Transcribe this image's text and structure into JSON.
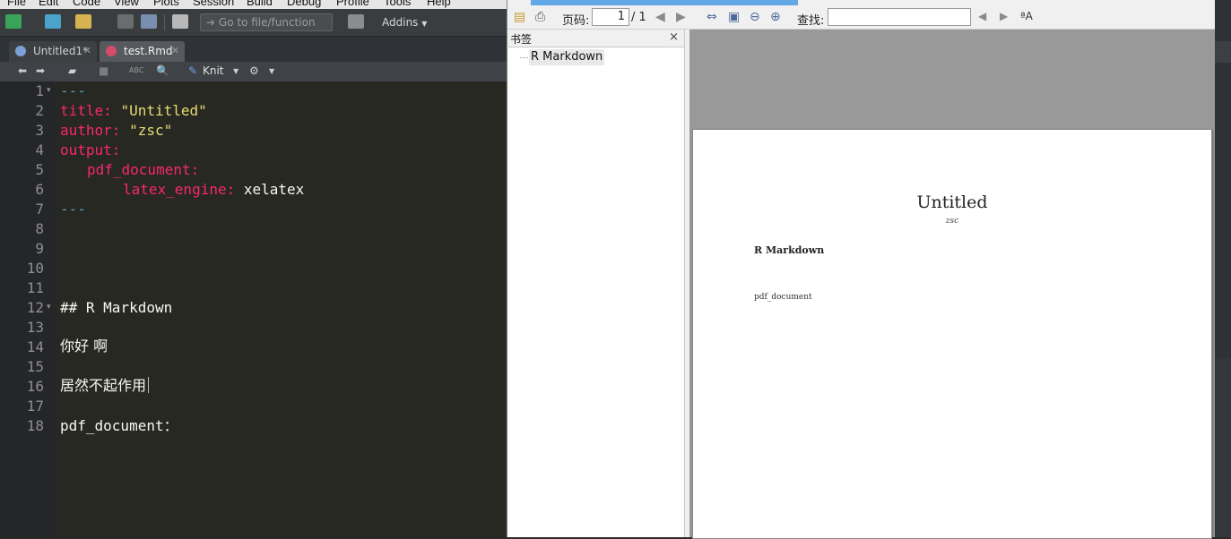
{
  "menubar": {
    "items": [
      "File",
      "Edit",
      "Code",
      "View",
      "Plots",
      "Session",
      "Build",
      "Debug",
      "Profile",
      "Tools",
      "Help"
    ]
  },
  "toolbar": {
    "goto_placeholder": "Go to file/function",
    "addins_label": "Addins"
  },
  "tabs": [
    {
      "label": "Untitled1*",
      "active": false
    },
    {
      "label": "test.Rmd",
      "active": true
    }
  ],
  "editor_toolbar": {
    "knit_label": "Knit",
    "abc_label": "ABC"
  },
  "editor": {
    "lines": [
      {
        "n": "1",
        "fold": true
      },
      {
        "n": "2"
      },
      {
        "n": "3"
      },
      {
        "n": "4"
      },
      {
        "n": "5"
      },
      {
        "n": "6"
      },
      {
        "n": "7"
      },
      {
        "n": "8"
      },
      {
        "n": "9"
      },
      {
        "n": "10"
      },
      {
        "n": "11"
      },
      {
        "n": "12",
        "fold": true
      },
      {
        "n": "13"
      },
      {
        "n": "14"
      },
      {
        "n": "15"
      },
      {
        "n": "16"
      },
      {
        "n": "17"
      },
      {
        "n": "18"
      }
    ],
    "yaml_open": "---",
    "title_key": "title:",
    "title_val": "\"Untitled\"",
    "author_key": "author:",
    "author_val": "\"zsc\"",
    "output_key": "output:",
    "pdf_key": "pdf_document:",
    "engine_key": "latex_engine:",
    "engine_val": "xelatex",
    "yaml_close": "---",
    "heading": "## R Markdown",
    "line14": "你好 啊",
    "line16": "居然不起作用",
    "line18": "pdf_document："
  },
  "pdf_viewer": {
    "page_label": "页码:",
    "page_current": "1",
    "page_total": "/ 1",
    "find_label": "查找:",
    "bookmarks_title": "书签",
    "bookmark_item": "R Markdown",
    "close_glyph": "×",
    "page": {
      "title": "Untitled",
      "author": "zsc",
      "heading": "R Markdown",
      "body": "pdf_document"
    }
  },
  "colors": {
    "editor_bg": "#272822",
    "yaml_key": "#f92672",
    "yaml_string": "#e6db74",
    "dashes": "#5a9fb0"
  }
}
